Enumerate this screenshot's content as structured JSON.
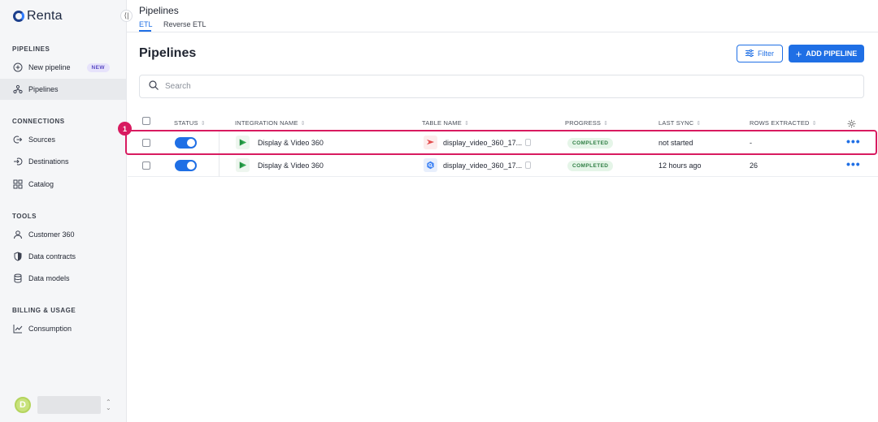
{
  "app": {
    "logo_text": "Renta",
    "collapse_icon": "⟨|"
  },
  "sidebar": {
    "sections": [
      {
        "title": "PIPELINES"
      },
      {
        "title": "CONNECTIONS"
      },
      {
        "title": "TOOLS"
      },
      {
        "title": "BILLING & USAGE"
      }
    ],
    "items": [
      {
        "label": "New pipeline",
        "icon": "plus-circle-icon",
        "badge": "NEW"
      },
      {
        "label": "Pipelines",
        "icon": "pipelines-icon",
        "active": true
      },
      {
        "label": "Sources",
        "icon": "sources-icon"
      },
      {
        "label": "Destinations",
        "icon": "destinations-icon"
      },
      {
        "label": "Catalog",
        "icon": "catalog-icon"
      },
      {
        "label": "Customer 360",
        "icon": "user-icon"
      },
      {
        "label": "Data contracts",
        "icon": "shield-icon"
      },
      {
        "label": "Data models",
        "icon": "database-icon"
      },
      {
        "label": "Consumption",
        "icon": "chart-icon"
      }
    ],
    "user": {
      "avatar_letter": "D"
    }
  },
  "header": {
    "title": "Pipelines",
    "tabs": [
      {
        "label": "ETL",
        "active": true
      },
      {
        "label": "Reverse ETL"
      }
    ]
  },
  "main": {
    "title": "Pipelines",
    "filter_label": "Filter",
    "add_label": "ADD PIPELINE",
    "search_placeholder": "Search",
    "columns": [
      "STATUS",
      "INTEGRATION NAME",
      "TABLE NAME",
      "PROGRESS",
      "LAST SYNC",
      "ROWS EXTRACTED"
    ],
    "rows": [
      {
        "enabled": true,
        "integration": "Display & Video 360",
        "table": "display_video_360_17...",
        "table_icon": "destination-red-icon",
        "progress": "COMPLETED",
        "last_sync": "not started",
        "rows": "-"
      },
      {
        "enabled": true,
        "integration": "Display & Video 360",
        "table": "display_video_360_17...",
        "table_icon": "bigquery-icon",
        "progress": "COMPLETED",
        "last_sync": "12 hours ago",
        "rows": "26"
      }
    ],
    "more_label": "•••"
  },
  "annotation": {
    "marker_label": "1"
  },
  "colors": {
    "accent": "#1f6fe5",
    "highlight": "#d81b60",
    "success": "#2e7d43"
  }
}
